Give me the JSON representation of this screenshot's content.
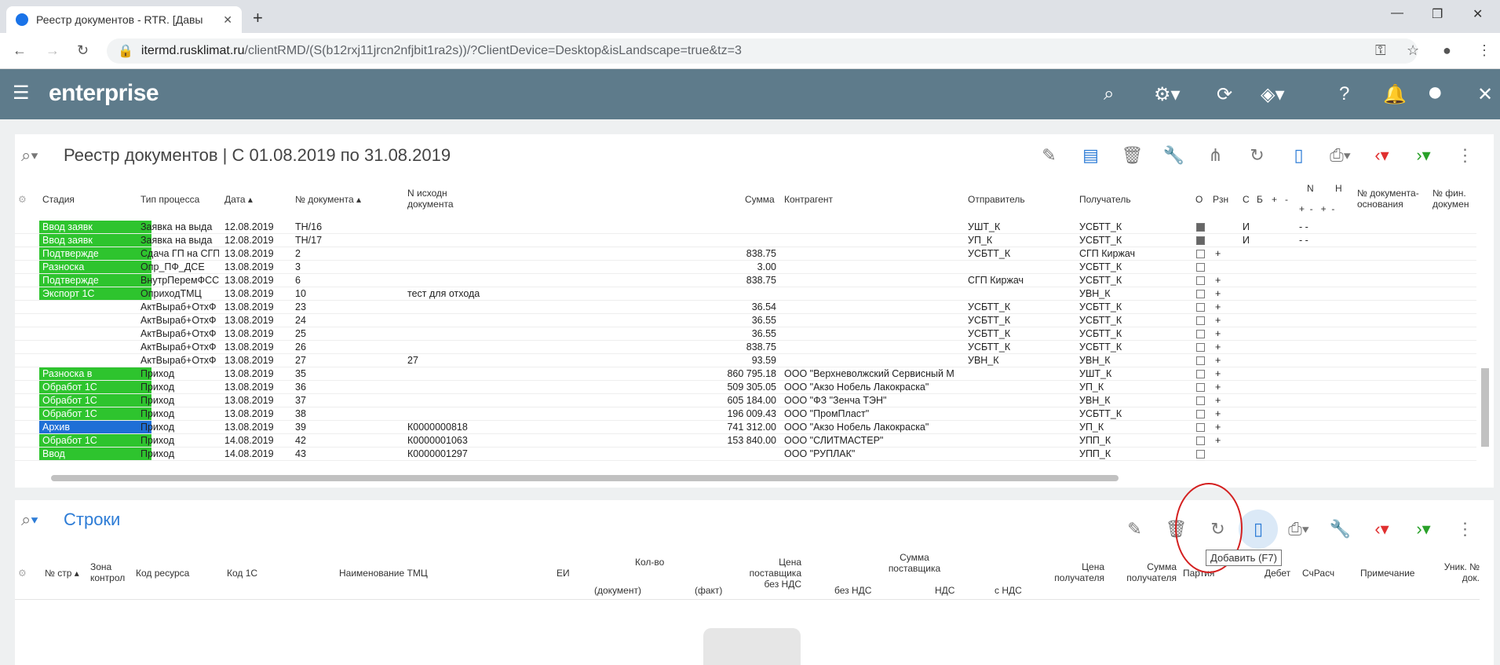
{
  "browser": {
    "tab_title": "Реестр документов - RTR. [Давы",
    "url_host": "itermd.rusklimat.ru",
    "url_path": "/clientRMD/(S(b12rxj11jrcn2nfjbit1ra2s))/?ClientDevice=Desktop&isLandscape=true&tz=3"
  },
  "app": {
    "logo": "enterprise"
  },
  "registry": {
    "title": "Реестр документов | С 01.08.2019 по 31.08.2019",
    "columns": {
      "stage": "Стадия",
      "process": "Тип процесса",
      "date": "Дата",
      "docnum": "№ документа",
      "srcnum": "N исходн документа",
      "sum": "Сумма",
      "counterparty": "Контрагент",
      "sender": "Отправитель",
      "receiver": "Получатель",
      "o": "О",
      "rzn": "Рзн",
      "s": "С",
      "b": "Б",
      "plus": "+",
      "minus": "-",
      "n": "N",
      "h": "Н",
      "basis": "№ документа- основания",
      "fin": "№ фин. докумен"
    },
    "rows": [
      {
        "stage": "Ввод заявк",
        "stage_color": "green",
        "process": "Заявка на выда",
        "date": "12.08.2019",
        "docnum": "ТН/16",
        "src": "",
        "sum": "",
        "cp": "",
        "sender": "УШТ_К",
        "receiver": "УСБТТ_К",
        "o": true,
        "rzn": "",
        "s": "И",
        "nm": "-  -"
      },
      {
        "stage": "Ввод заявк",
        "stage_color": "green",
        "process": "Заявка на выда",
        "date": "12.08.2019",
        "docnum": "ТН/17",
        "src": "",
        "sum": "",
        "cp": "",
        "sender": "УП_К",
        "receiver": "УСБТТ_К",
        "o": true,
        "rzn": "",
        "s": "И",
        "nm": "-  -"
      },
      {
        "stage": "Подтвержде",
        "stage_color": "green",
        "process": "Сдача ГП на СГП",
        "date": "13.08.2019",
        "docnum": "2",
        "src": "",
        "sum": "838.75",
        "cp": "",
        "sender": "УСБТТ_К",
        "receiver": "СГП Киржач",
        "o": false,
        "rzn": "+",
        "s": "",
        "nm": ""
      },
      {
        "stage": "Разноска",
        "stage_color": "green",
        "process": "Опр_ПФ_ДСЕ",
        "date": "13.08.2019",
        "docnum": "3",
        "src": "",
        "sum": "3.00",
        "cp": "",
        "sender": "",
        "receiver": "УСБТТ_К",
        "o": false,
        "rzn": "",
        "s": "",
        "nm": ""
      },
      {
        "stage": "Подтвержде",
        "stage_color": "green",
        "process": "ВнутрПеремФСС",
        "date": "13.08.2019",
        "docnum": "6",
        "src": "",
        "sum": "838.75",
        "cp": "",
        "sender": "СГП Киржач",
        "receiver": "УСБТТ_К",
        "o": false,
        "rzn": "+",
        "s": "",
        "nm": ""
      },
      {
        "stage": "Экспорт 1С",
        "stage_color": "green",
        "process": "ОприходТМЦ",
        "date": "13.08.2019",
        "docnum": "10",
        "src": "тест для отхода",
        "sum": "",
        "cp": "",
        "sender": "",
        "receiver": "УВН_К",
        "o": false,
        "rzn": "+",
        "s": "",
        "nm": ""
      },
      {
        "stage": "",
        "stage_color": "",
        "process": "АктВыраб+ОтхФ",
        "date": "13.08.2019",
        "docnum": "23",
        "src": "",
        "sum": "36.54",
        "cp": "",
        "sender": "УСБТТ_К",
        "receiver": "УСБТТ_К",
        "o": false,
        "rzn": "+",
        "s": "",
        "nm": ""
      },
      {
        "stage": "",
        "stage_color": "",
        "process": "АктВыраб+ОтхФ",
        "date": "13.08.2019",
        "docnum": "24",
        "src": "",
        "sum": "36.55",
        "cp": "",
        "sender": "УСБТТ_К",
        "receiver": "УСБТТ_К",
        "o": false,
        "rzn": "+",
        "s": "",
        "nm": ""
      },
      {
        "stage": "",
        "stage_color": "",
        "process": "АктВыраб+ОтхФ",
        "date": "13.08.2019",
        "docnum": "25",
        "src": "",
        "sum": "36.55",
        "cp": "",
        "sender": "УСБТТ_К",
        "receiver": "УСБТТ_К",
        "o": false,
        "rzn": "+",
        "s": "",
        "nm": ""
      },
      {
        "stage": "",
        "stage_color": "",
        "process": "АктВыраб+ОтхФ",
        "date": "13.08.2019",
        "docnum": "26",
        "src": "",
        "sum": "838.75",
        "cp": "",
        "sender": "УСБТТ_К",
        "receiver": "УСБТТ_К",
        "o": false,
        "rzn": "+",
        "s": "",
        "nm": ""
      },
      {
        "stage": "",
        "stage_color": "",
        "process": "АктВыраб+ОтхФ",
        "date": "13.08.2019",
        "docnum": "27",
        "src": "27",
        "sum": "93.59",
        "cp": "",
        "sender": "УВН_К",
        "receiver": "УВН_К",
        "o": false,
        "rzn": "+",
        "s": "",
        "nm": ""
      },
      {
        "stage": "Разноска в",
        "stage_color": "green",
        "process": "Приход",
        "date": "13.08.2019",
        "docnum": "35",
        "src": "",
        "sum": "860 795.18",
        "cp": "ООО \"Верхневолжский Сервисный М",
        "sender": "",
        "receiver": "УШТ_К",
        "o": false,
        "rzn": "+",
        "s": "",
        "nm": ""
      },
      {
        "stage": "Обработ 1С",
        "stage_color": "green",
        "process": "Приход",
        "date": "13.08.2019",
        "docnum": "36",
        "src": "",
        "sum": "509 305.05",
        "cp": "ООО \"Акзо Нобель Лакокраска\"",
        "sender": "",
        "receiver": "УП_К",
        "o": false,
        "rzn": "+",
        "s": "",
        "nm": ""
      },
      {
        "stage": "Обработ 1С",
        "stage_color": "green",
        "process": "Приход",
        "date": "13.08.2019",
        "docnum": "37",
        "src": "",
        "sum": "605 184.00",
        "cp": "ООО \"ФЗ \"Зенча ТЭН\"",
        "sender": "",
        "receiver": "УВН_К",
        "o": false,
        "rzn": "+",
        "s": "",
        "nm": ""
      },
      {
        "stage": "Обработ 1С",
        "stage_color": "green",
        "process": "Приход",
        "date": "13.08.2019",
        "docnum": "38",
        "src": "",
        "sum": "196 009.43",
        "cp": "ООО \"ПромПласт\"",
        "sender": "",
        "receiver": "УСБТТ_К",
        "o": false,
        "rzn": "+",
        "s": "",
        "nm": ""
      },
      {
        "stage": "Архив",
        "stage_color": "blue",
        "process": "Приход",
        "date": "13.08.2019",
        "docnum": "39",
        "src": "К0000000818",
        "sum": "741 312.00",
        "cp": "ООО \"Акзо Нобель Лакокраска\"",
        "sender": "",
        "receiver": "УП_К",
        "o": false,
        "rzn": "+",
        "s": "",
        "nm": ""
      },
      {
        "stage": "Обработ 1С",
        "stage_color": "green",
        "process": "Приход",
        "date": "14.08.2019",
        "docnum": "42",
        "src": "К0000001063",
        "sum": "153 840.00",
        "cp": "ООО \"СЛИТМАСТЕР\"",
        "sender": "",
        "receiver": "УПП_К",
        "o": false,
        "rzn": "+",
        "s": "",
        "nm": ""
      },
      {
        "stage": "Ввод",
        "stage_color": "green",
        "process": "Приход",
        "date": "14.08.2019",
        "docnum": "43",
        "src": "К0000001297",
        "sum": "",
        "cp": "ООО \"РУПЛАК\"",
        "sender": "",
        "receiver": "УПП_К",
        "o": false,
        "rzn": "",
        "s": "",
        "nm": ""
      }
    ]
  },
  "lines": {
    "title": "Строки",
    "tooltip": "Добавить (F7)",
    "columns": {
      "num": "№ стр",
      "zone": "Зона контрол",
      "res": "Код ресурса",
      "code1c": "Код 1С",
      "name": "Наименование ТМЦ",
      "ei": "ЕИ",
      "qty": "Кол-во",
      "qty_doc": "(документ)",
      "qty_fact": "(факт)",
      "price": "Цена поставщика без НДС",
      "sum_sup": "Сумма поставщика",
      "no_vat": "без НДС",
      "vat": "НДС",
      "with_vat": "с НДС",
      "price_rec": "Цена получателя",
      "sum_rec": "Сумма получателя",
      "batch": "Партия",
      "debit": "Дебет",
      "acc": "СчРасч",
      "note": "Примечание",
      "uniq": "Уник. № док."
    }
  },
  "colors": {
    "appbar": "#5e7b8b",
    "stage_green": "#2ec42e",
    "stage_blue": "#1f6fd6",
    "accent": "#2d7cd6"
  }
}
